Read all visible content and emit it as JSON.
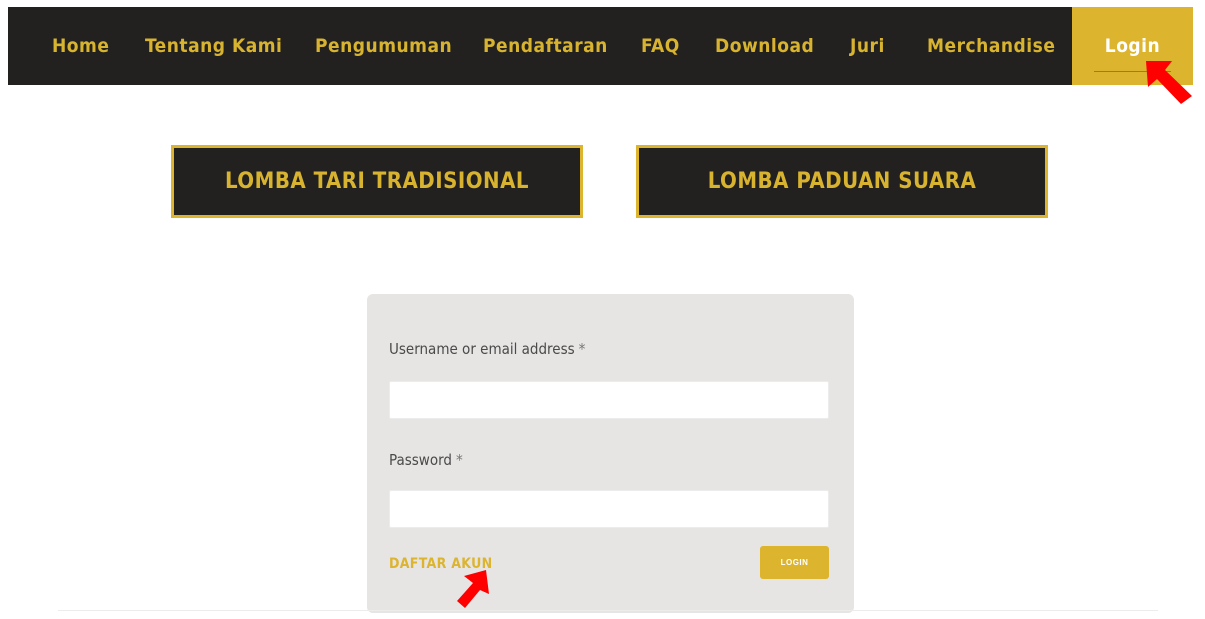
{
  "nav": {
    "items": [
      {
        "label": "Home"
      },
      {
        "label": "Tentang Kami"
      },
      {
        "label": "Pengumuman"
      },
      {
        "label": "Pendaftaran"
      },
      {
        "label": "FAQ"
      },
      {
        "label": "Download"
      },
      {
        "label": "Juri"
      },
      {
        "label": "Merchandise"
      },
      {
        "label": "Login"
      }
    ],
    "active_item": "Login"
  },
  "categories": [
    {
      "label": "LOMBA TARI TRADISIONAL"
    },
    {
      "label": "LOMBA PADUAN SUARA"
    }
  ],
  "login_form": {
    "username_label": "Username or email address",
    "password_label": "Password",
    "required_mark": "*",
    "username_value": "",
    "password_value": "",
    "register_link": "DAFTAR AKUN",
    "submit_label": "LOGIN"
  },
  "colors": {
    "accent": "#dcb42e",
    "nav_background": "#222120",
    "card_background": "#e6e5e4",
    "annotation_arrow": "#ff0000"
  },
  "icons": {
    "annotation": "red-pointer-arrow-icon"
  }
}
